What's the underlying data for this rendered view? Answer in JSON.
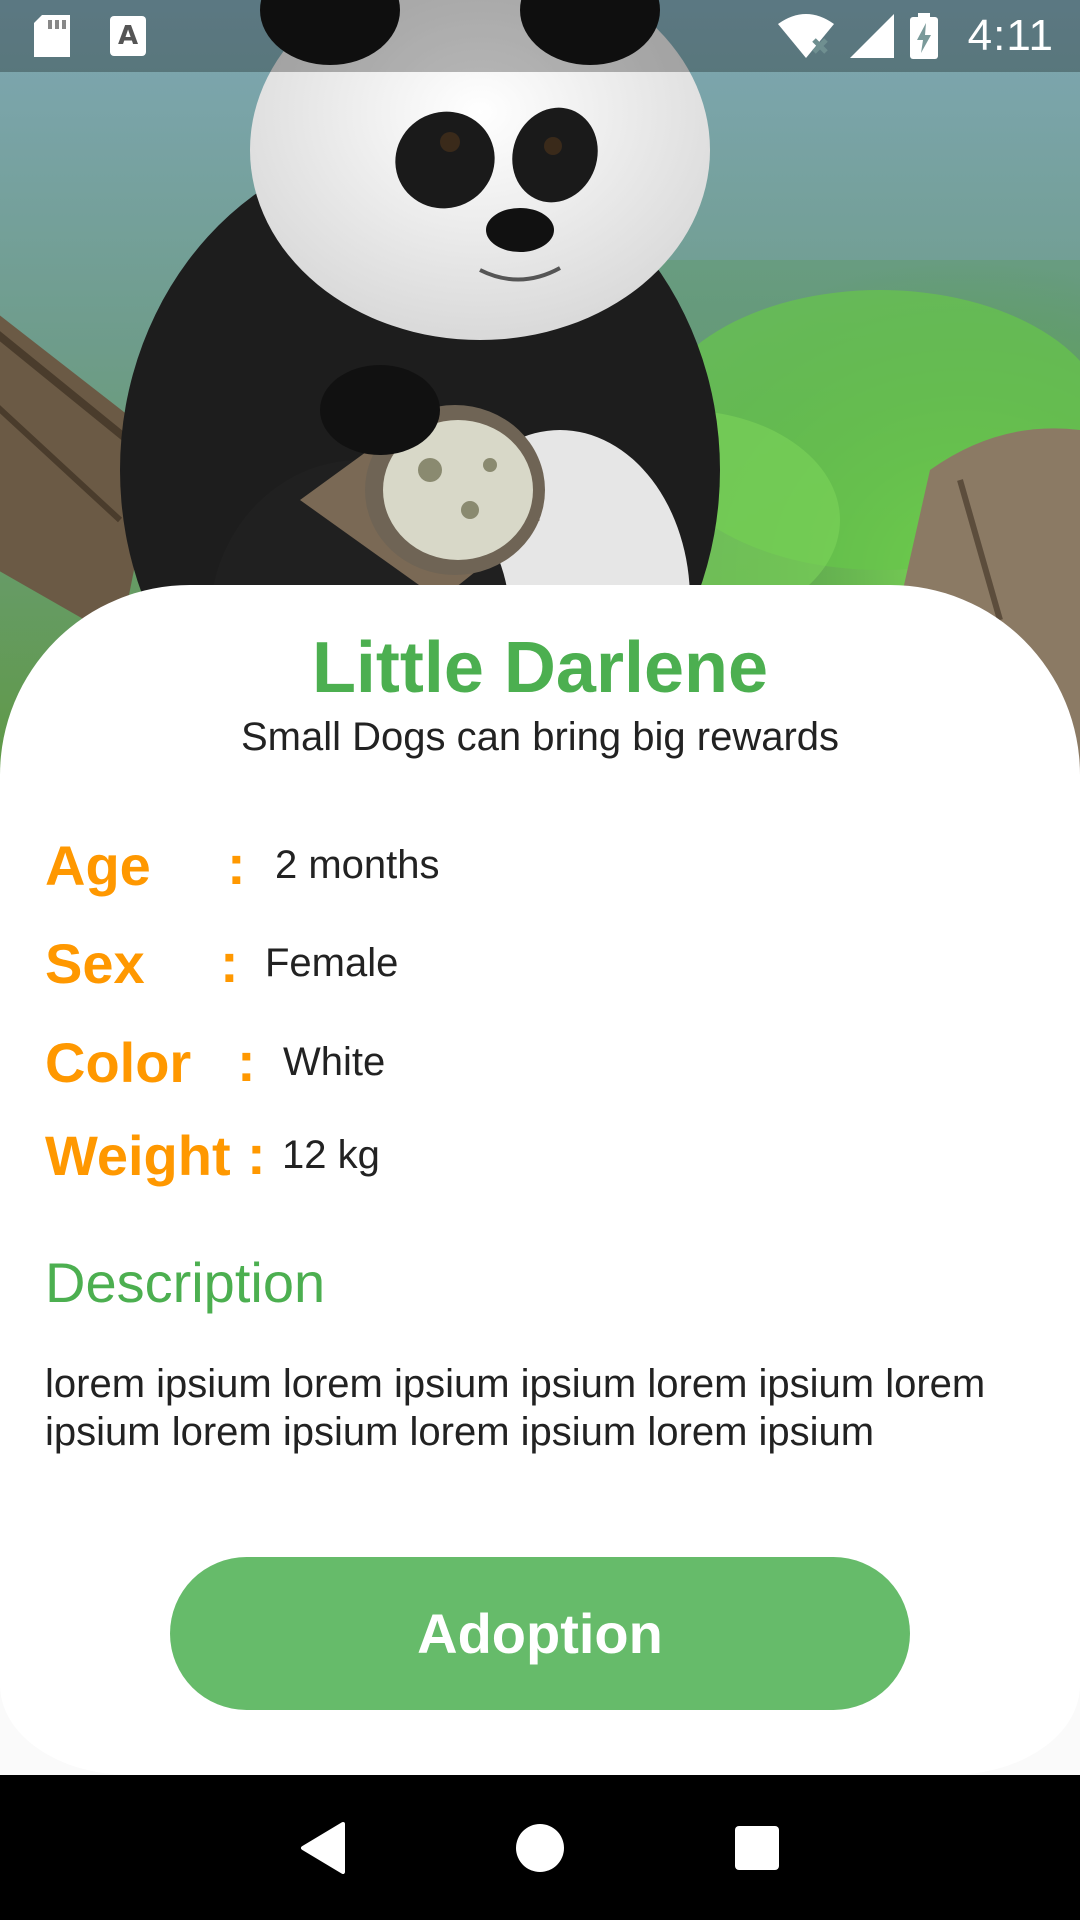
{
  "status_bar": {
    "time": "4:11",
    "icons": [
      "sd-card-icon",
      "font-download-icon",
      "wifi-off-icon",
      "signal-icon",
      "battery-charging-icon"
    ]
  },
  "hero": {
    "image_subject": "panda sitting on a log"
  },
  "pet": {
    "name": "Little Darlene",
    "tagline": "Small Dogs can bring big rewards"
  },
  "attributes": [
    {
      "label": "Age",
      "colon": ":",
      "value": "2 months"
    },
    {
      "label": "Sex",
      "colon": ":",
      "value": "Female"
    },
    {
      "label": "Color",
      "colon": ":",
      "value": "White"
    },
    {
      "label": "Weight",
      "colon": ":",
      "value": "12 kg"
    }
  ],
  "description": {
    "title": "Description",
    "body": "lorem ipsium lorem ipsium ipsium lorem ipsium lorem ipsium lorem ipsium lorem ipsium lorem ipsium"
  },
  "actions": {
    "adopt_label": "Adoption"
  },
  "colors": {
    "accent_green": "#4caf50",
    "button_green": "#66bb6a",
    "label_orange": "#ff9800"
  },
  "nav_bar": {
    "icons": [
      "back-icon",
      "home-icon",
      "recents-icon"
    ]
  }
}
